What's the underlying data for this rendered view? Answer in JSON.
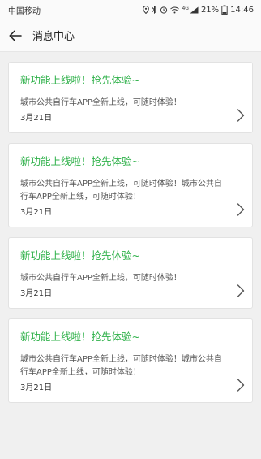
{
  "status_bar": {
    "carrier": "中国移动",
    "network": "4G",
    "battery_percent": "21%",
    "time": "14:46"
  },
  "header": {
    "title": "消息中心"
  },
  "messages": [
    {
      "title": "新功能上线啦！抢先体验~",
      "body": "城市公共自行车APP全新上线，可随时体验！",
      "date": "3月21日"
    },
    {
      "title": "新功能上线啦！抢先体验~",
      "body": "城市公共自行车APP全新上线，可随时体验！城市公共自行车APP全新上线，可随时体验！",
      "date": "3月21日"
    },
    {
      "title": "新功能上线啦！抢先体验~",
      "body": "城市公共自行车APP全新上线，可随时体验！",
      "date": "3月21日"
    },
    {
      "title": "新功能上线啦！抢先体验~",
      "body": "城市公共自行车APP全新上线，可随时体验！城市公共自行车APP全新上线，可随时体验！",
      "date": "3月21日"
    }
  ],
  "colors": {
    "title_green": "#2fb14a",
    "background": "#f0f0f0"
  }
}
